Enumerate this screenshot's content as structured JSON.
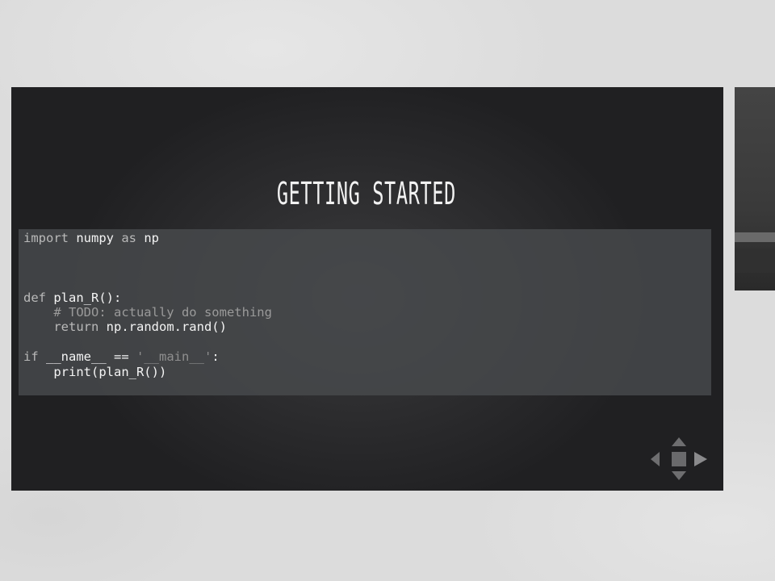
{
  "slide": {
    "title": "GETTING STARTED",
    "code": {
      "line1": {
        "kw_import": "import",
        "module": " numpy ",
        "kw_as": "as",
        "alias": " np"
      },
      "line5": {
        "kw_def": "def",
        "sig": " plan_R():"
      },
      "line6": {
        "comment": "    # TODO: actually do something"
      },
      "line7": {
        "kw_return": "    return",
        "expr": " np.random.rand()"
      },
      "line9": {
        "kw_if": "if",
        "name": " __name__ ",
        "op": "==",
        "str": " '__main__'",
        "colon": ":"
      },
      "line10": {
        "call": "    print(plan_R())"
      }
    }
  },
  "navigation": {
    "up_icon": "arrow-up",
    "down_icon": "arrow-down",
    "left_icon": "arrow-left",
    "right_icon": "arrow-right"
  },
  "colors": {
    "backdrop": "#dcdcdc",
    "slide_bg": "#2c2c2e",
    "code_bg": "#48494d",
    "title": "#f2f2f2"
  }
}
